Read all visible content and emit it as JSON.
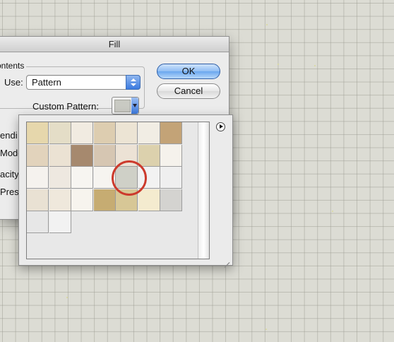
{
  "dialog": {
    "title": "Fill",
    "contents_group_label": "ontents",
    "use_label": "Use:",
    "use_value": "Pattern",
    "custom_pattern_label": "Custom Pattern:",
    "ok_label": "OK",
    "cancel_label": "Cancel",
    "partial_labels": [
      "endi",
      "Mode",
      "acity",
      "Prese"
    ]
  },
  "picker": {
    "tile_colors": [
      "#e6d7ac",
      "#e4ddc7",
      "#f1ebe1",
      "#ddcdb0",
      "#ece4d4",
      "#f1ede4",
      "#c3a377",
      "#e2d3bc",
      "#ebe2d3",
      "#a6896e",
      "#d6c6b2",
      "#ece2d5",
      "#dcd1ad",
      "#f5f2ec",
      "#f5f2ee",
      "#eee8e0",
      "#f7f5f1",
      "#f6f4f0",
      "#cfd0c7",
      "#f2f2f2",
      "#efefef",
      "#e9e1d3",
      "#efe8dc",
      "#f7f4ee",
      "#c6ac72",
      "#d7c796",
      "#f4ebcf",
      "#d4d3d0",
      "#e7e7e7",
      "#f2f2f2"
    ],
    "selected_index": 18
  }
}
